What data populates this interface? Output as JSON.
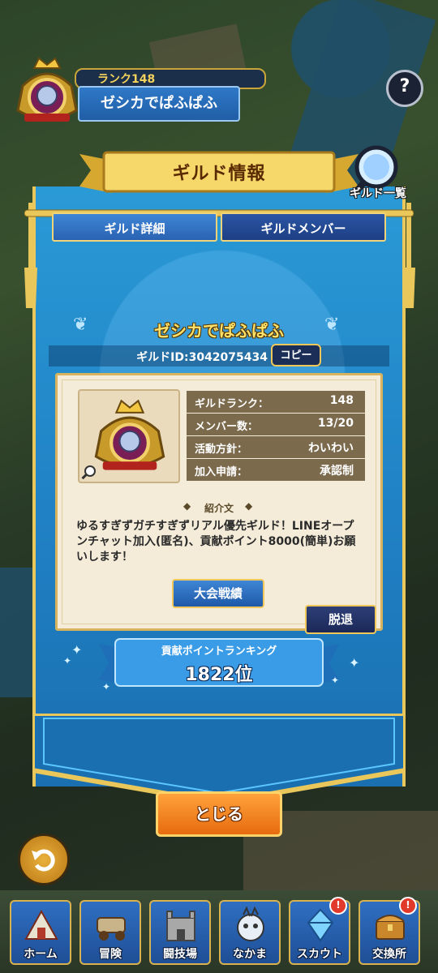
{
  "header": {
    "rank_label": "ランク148",
    "guild_name": "ゼシカでぱふぱふ"
  },
  "help_label": "?",
  "dialog": {
    "title": "ギルド情報",
    "list_button_label": "ギルド一覧",
    "tabs": [
      {
        "label": "ギルド詳細"
      },
      {
        "label": "ギルドメンバー"
      }
    ],
    "guild_name": "ゼシカでぱふぱふ",
    "guild_id": "ギルドID:3042075434",
    "copy_label": "コピー",
    "stats": [
      {
        "key": "ギルドランク：",
        "value": "148"
      },
      {
        "key": "メンバー数：",
        "value": "13/20"
      },
      {
        "key": "活動方針：",
        "value": "わいわい"
      },
      {
        "key": "加入申請：",
        "value": "承認制"
      }
    ],
    "intro_heading": "紹介文",
    "intro_text": "ゆるすぎずガチすぎずリアル優先ギルド！LINEオープンチャット加入(匿名)、貢献ポイント8000(簡単)お願いします！",
    "tournament_label": "大会戦績",
    "leave_label": "脱退",
    "ranking_label": "貢献ポイントランキング",
    "ranking_value": "1822位",
    "close_label": "とじる"
  },
  "nav": {
    "items": [
      {
        "label": "ホーム",
        "alert": ""
      },
      {
        "label": "冒険",
        "alert": ""
      },
      {
        "label": "闘技場",
        "alert": ""
      },
      {
        "label": "なかま",
        "alert": ""
      },
      {
        "label": "スカウト",
        "alert": "!"
      },
      {
        "label": "交換所",
        "alert": "!"
      }
    ]
  },
  "colors": {
    "panel_blue": "#1f7fc2",
    "gold": "#e9c75a",
    "close_orange": "#f08a20"
  }
}
